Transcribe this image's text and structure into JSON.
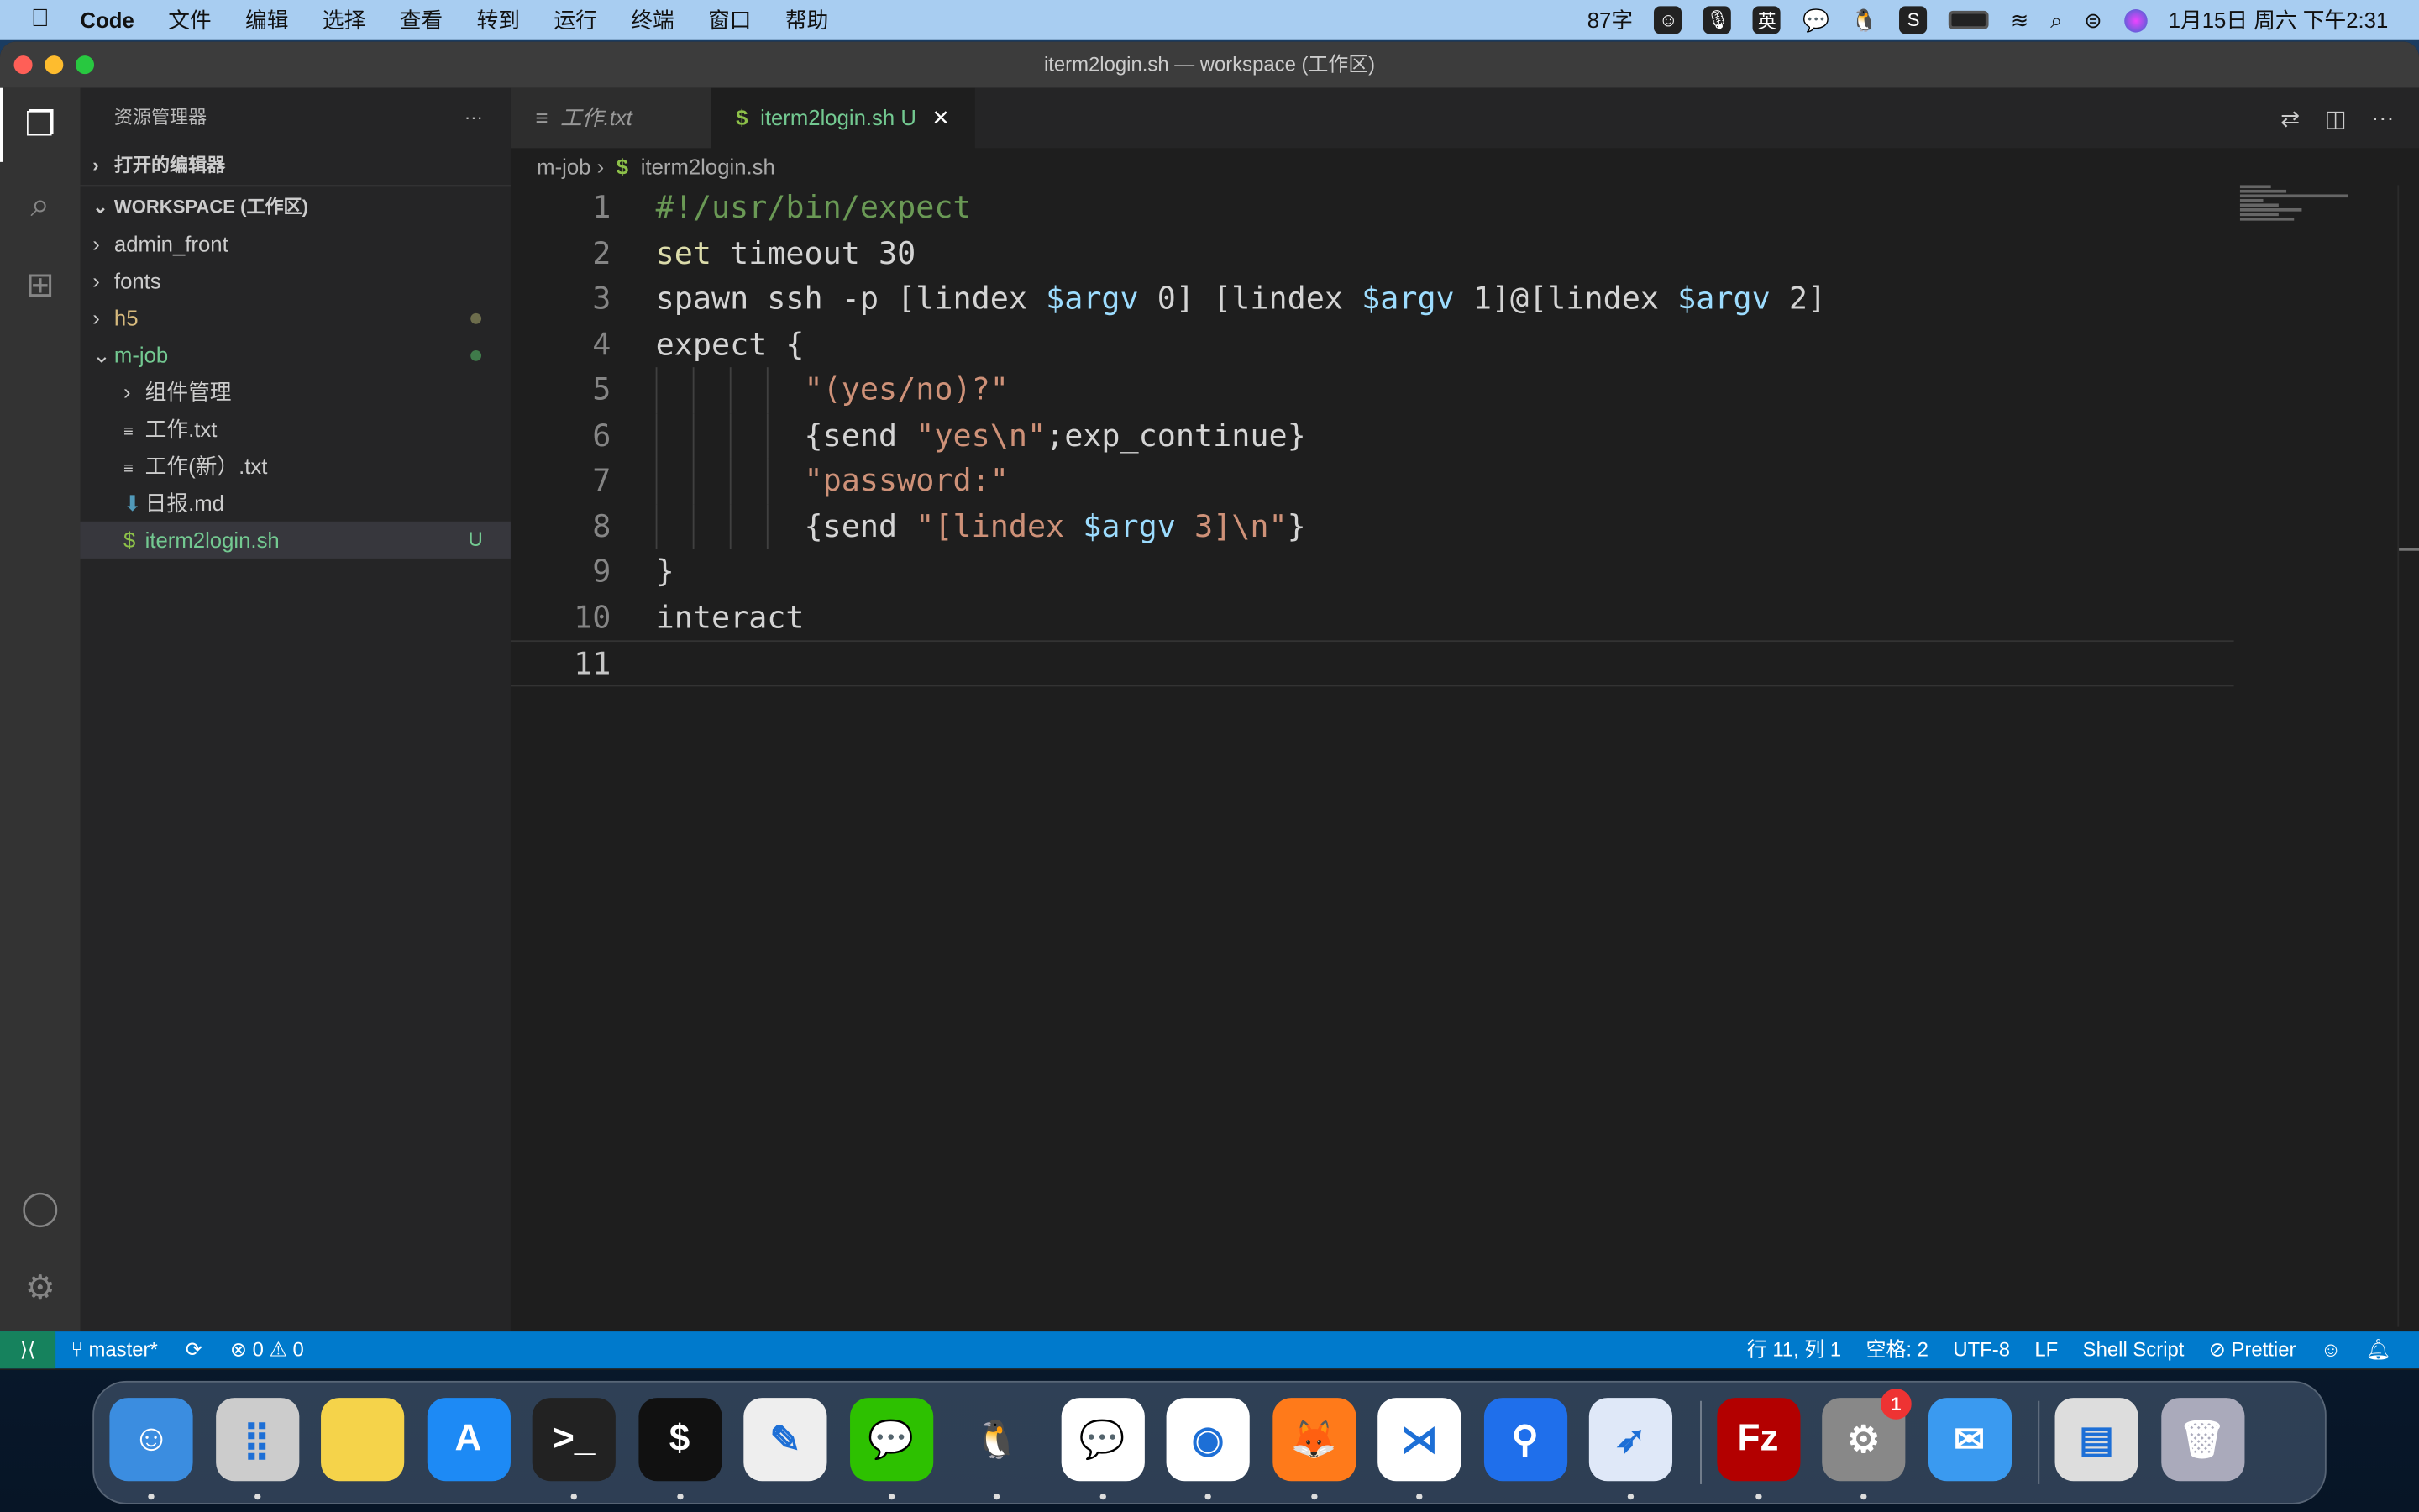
{
  "menubar": {
    "app": "Code",
    "items": [
      "文件",
      "编辑",
      "选择",
      "查看",
      "转到",
      "运行",
      "终端",
      "窗口",
      "帮助"
    ],
    "word_count": "87字",
    "input_icons": [
      "emoji-icon",
      "mic-icon"
    ],
    "input_lang": "英",
    "clock": "1月15日 周六 下午2:31"
  },
  "window": {
    "title": "iterm2login.sh — workspace (工作区)"
  },
  "sidebar": {
    "title": "资源管理器",
    "more": "···",
    "open_editors": "打开的编辑器",
    "workspace": "WORKSPACE (工作区)",
    "items": [
      {
        "label": "admin_front",
        "type": "folder",
        "level": 0,
        "color": "#cccccc"
      },
      {
        "label": "fonts",
        "type": "folder",
        "level": 0,
        "color": "#cccccc"
      },
      {
        "label": "h5",
        "type": "folder",
        "level": 0,
        "color": "#d7ba7d",
        "dot": "modified"
      },
      {
        "label": "m-job",
        "type": "folder-open",
        "level": 0,
        "color": "#73c991",
        "dot": "untracked"
      },
      {
        "label": "组件管理",
        "type": "folder",
        "level": 1,
        "color": "#cccccc"
      },
      {
        "label": "工作.txt",
        "type": "txt",
        "level": 1,
        "color": "#cccccc"
      },
      {
        "label": "工作(新）.txt",
        "type": "txt",
        "level": 1,
        "color": "#cccccc"
      },
      {
        "label": "日报.md",
        "type": "md",
        "level": 1,
        "color": "#cccccc"
      },
      {
        "label": "iterm2login.sh",
        "type": "sh",
        "level": 1,
        "color": "#73c991",
        "badge": "U",
        "selected": true
      }
    ]
  },
  "tabs": [
    {
      "label": "工作.txt",
      "icon": "≡",
      "active": false
    },
    {
      "label": "iterm2login.sh",
      "icon": "$",
      "badge": "U",
      "active": true
    }
  ],
  "breadcrumb": {
    "folder": "m-job",
    "file": "iterm2login.sh"
  },
  "code": {
    "current_line": 11,
    "lines": [
      [
        [
          "#!/usr/bin/expect",
          "comment"
        ]
      ],
      [
        [
          "set",
          "kw"
        ],
        [
          " timeout 30",
          ""
        ]
      ],
      [
        [
          "spawn ssh -p [lindex ",
          ""
        ],
        [
          "$argv",
          "var"
        ],
        [
          " 0] [lindex ",
          ""
        ],
        [
          "$argv",
          "var"
        ],
        [
          " 1]@[lindex ",
          ""
        ],
        [
          "$argv",
          "var"
        ],
        [
          " 2]",
          ""
        ]
      ],
      [
        [
          "expect {",
          ""
        ]
      ],
      [
        [
          "        ",
          ""
        ],
        [
          "\"(yes/no)?\"",
          "str"
        ]
      ],
      [
        [
          "        {send ",
          ""
        ],
        [
          "\"yes\\n\"",
          "str"
        ],
        [
          ";exp_continue}",
          ""
        ]
      ],
      [
        [
          "        ",
          ""
        ],
        [
          "\"password:\"",
          "str"
        ]
      ],
      [
        [
          "        {send ",
          ""
        ],
        [
          "\"[lindex ",
          "str"
        ],
        [
          "$argv",
          "var"
        ],
        [
          " 3]\\n\"",
          "str"
        ],
        [
          "}",
          ""
        ]
      ],
      [
        [
          "}",
          ""
        ]
      ],
      [
        [
          "interact",
          ""
        ]
      ],
      []
    ]
  },
  "status": {
    "branch": "master*",
    "errors": "0",
    "warnings": "0",
    "position": "行 11, 列 1",
    "spaces": "空格: 2",
    "encoding": "UTF-8",
    "eol": "LF",
    "language": "Shell Script",
    "formatter": "Prettier"
  },
  "dock": {
    "apps": [
      "finder",
      "launchpad",
      "notes",
      "app-store",
      "terminal",
      "iterm",
      "textedit",
      "wechat",
      "qq",
      "feishu-chat",
      "chrome",
      "firefox",
      "vscode",
      "pin-app",
      "lark",
      "filezilla",
      "system-preferences",
      "mail",
      "downloads-stack",
      "trash"
    ],
    "system_preferences_badge": "1"
  },
  "colors": {
    "accent": "#007acc",
    "remote": "#16825d",
    "untracked": "#73c991"
  }
}
